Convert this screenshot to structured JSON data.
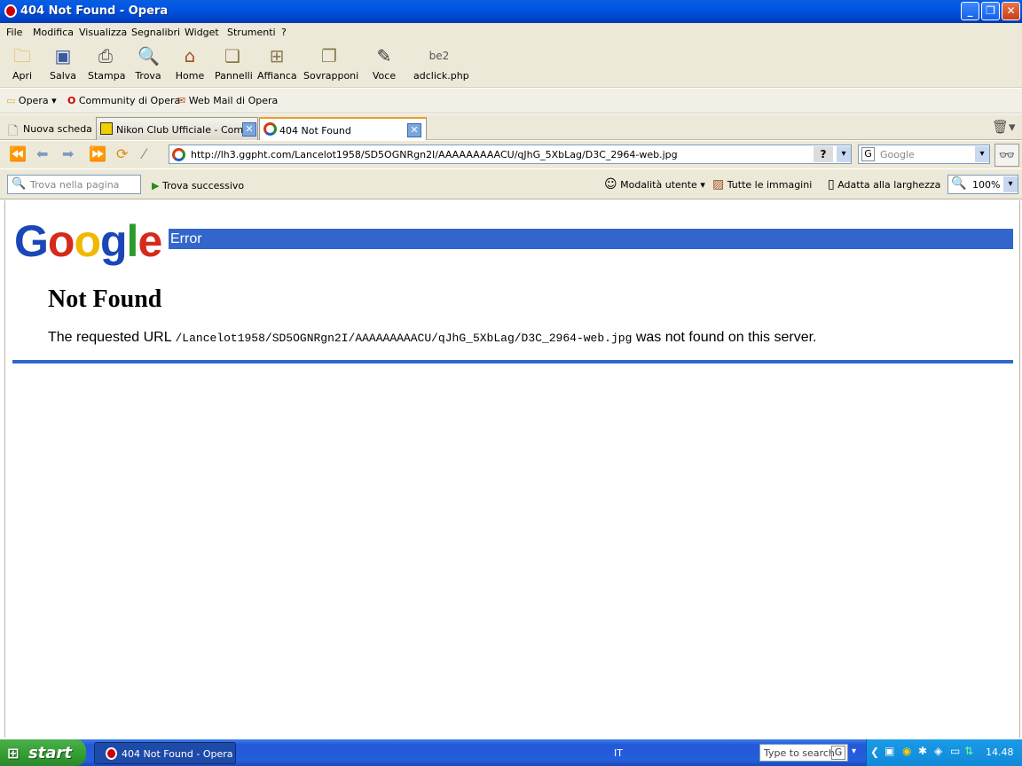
{
  "window": {
    "title": "404 Not Found - Opera"
  },
  "menu": [
    "File",
    "Modifica",
    "Visualizza",
    "Segnalibri",
    "Widget",
    "Strumenti",
    "?"
  ],
  "toolbar": [
    {
      "label": "Apri",
      "icon": "folder-icon"
    },
    {
      "label": "Salva",
      "icon": "save-icon"
    },
    {
      "label": "Stampa",
      "icon": "print-icon"
    },
    {
      "label": "Trova",
      "icon": "find-icon"
    },
    {
      "label": "Home",
      "icon": "home-icon"
    },
    {
      "label": "Pannelli",
      "icon": "panels-icon"
    },
    {
      "label": "Affianca",
      "icon": "tile-icon"
    },
    {
      "label": "Sovrapponi",
      "icon": "cascade-icon"
    },
    {
      "label": "Voce",
      "icon": "voice-icon"
    },
    {
      "label": "adclick.php",
      "icon": "be2-icon"
    }
  ],
  "bookmarks": [
    "Opera",
    "Community di Opera",
    "Web Mail di Opera"
  ],
  "tabs": [
    {
      "label": "Nuova scheda"
    },
    {
      "label": "Nikon Club Ufficiale - Com..."
    },
    {
      "label": "404 Not Found"
    }
  ],
  "address": {
    "url": "http://lh3.ggpht.com/Lancelot1958/SD5OGNRgn2I/AAAAAAAAACU/qJhG_5XbLag/D3C_2964-web.jpg",
    "help": "?"
  },
  "search": {
    "placeholder": "Google"
  },
  "findbar": {
    "placeholder": "Trova nella pagina",
    "next": "Trova successivo",
    "user_mode": "Modalità utente",
    "images": "Tutte le immagini",
    "fit": "Adatta alla larghezza",
    "zoom": "100%"
  },
  "content": {
    "logo_letters": [
      "G",
      "o",
      "o",
      "g",
      "l",
      "e"
    ],
    "logo_colors": [
      "#1a47b8",
      "#d62a1a",
      "#f0b800",
      "#1a47b8",
      "#2a9a2a",
      "#d62a1a"
    ],
    "error_label": "Error",
    "heading": "Not Found",
    "msg_prefix": "The requested URL ",
    "msg_path": "/Lancelot1958/SD5OGNRgn2I/AAAAAAAAACU/qJhG_5XbLag/D3C_2964-web.jpg",
    "msg_suffix": " was not found on this server."
  },
  "taskbar": {
    "start": "start",
    "task": "404 Not Found - Opera",
    "lang": "IT",
    "search_placeholder": "Type to search",
    "clock": "14.48"
  }
}
